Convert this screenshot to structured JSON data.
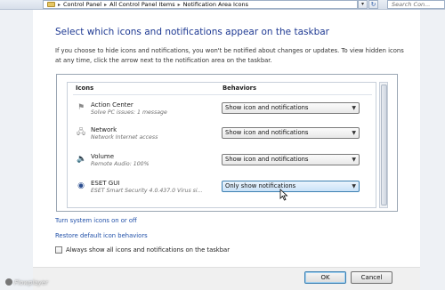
{
  "address_bar": {
    "crumbs": [
      "Control Panel",
      "All Control Panel Items",
      "Notification Area Icons"
    ],
    "search_placeholder": "Search Con..."
  },
  "main": {
    "title": "Select which icons and notifications appear on the taskbar",
    "description": "If you choose to hide icons and notifications, you won't be notified about changes or updates. To view hidden icons at any time, click the arrow next to the notification area on the taskbar.",
    "col_icons": "Icons",
    "col_behaviors": "Behaviors",
    "rows": [
      {
        "name": "Action Center",
        "sub": "Solve PC issues: 1 message",
        "behavior": "Show icon and notifications",
        "icon": "flag-icon"
      },
      {
        "name": "Network",
        "sub": "Network Internet access",
        "behavior": "Show icon and notifications",
        "icon": "network-icon"
      },
      {
        "name": "Volume",
        "sub": "Remote Audio: 100%",
        "behavior": "Show icon and notifications",
        "icon": "speaker-icon"
      },
      {
        "name": "ESET GUI",
        "sub": "ESET Smart Security 4.0.437.0 Virus si...",
        "behavior": "Only show notifications",
        "icon": "eset-icon"
      }
    ],
    "link_system_icons": "Turn system icons on or off",
    "link_restore": "Restore default icon behaviors",
    "always_show_label": "Always show all icons and notifications on the taskbar",
    "always_show_checked": false
  },
  "buttons": {
    "ok": "OK",
    "cancel": "Cancel"
  },
  "watermark": "Flowplayer",
  "colors": {
    "title": "#1f3a93",
    "link": "#1f4fa8",
    "highlight": "#c9e2f8"
  }
}
